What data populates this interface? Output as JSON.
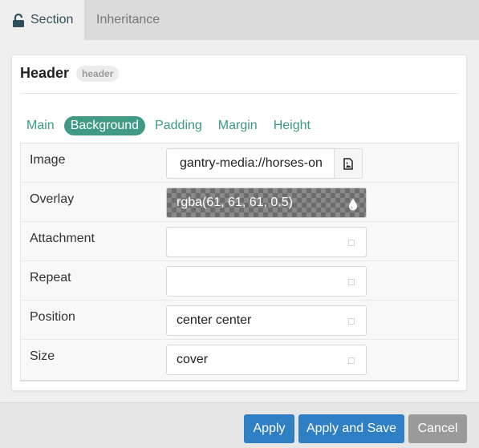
{
  "top_tabs": [
    {
      "label": "Section",
      "icon": "unlock-icon",
      "active": true
    },
    {
      "label": "Inheritance",
      "active": false
    }
  ],
  "card": {
    "title": "Header",
    "badge": "header"
  },
  "sub_tabs": [
    {
      "label": "Main",
      "active": false
    },
    {
      "label": "Background",
      "active": true
    },
    {
      "label": "Padding",
      "active": false
    },
    {
      "label": "Margin",
      "active": false
    },
    {
      "label": "Height",
      "active": false
    }
  ],
  "fields": {
    "image": {
      "label": "Image",
      "value": "gantry-media://horses-on",
      "button_icon": "image-file-icon"
    },
    "overlay": {
      "label": "Overlay",
      "value": "rgba(61, 61, 61, 0.5)",
      "icon": "color-drop-icon"
    },
    "attachment": {
      "label": "Attachment",
      "value": ""
    },
    "repeat": {
      "label": "Repeat",
      "value": ""
    },
    "position": {
      "label": "Position",
      "value": "center center"
    },
    "size": {
      "label": "Size",
      "value": "cover"
    }
  },
  "footer": {
    "apply_label": "Apply",
    "apply_save_label": "Apply and Save",
    "cancel_label": "Cancel"
  },
  "colors": {
    "accent": "#409a84",
    "primary_button": "#2f7fc4",
    "cancel_button": "#9a9a9a",
    "tab_active_text": "#2f4f5c"
  }
}
